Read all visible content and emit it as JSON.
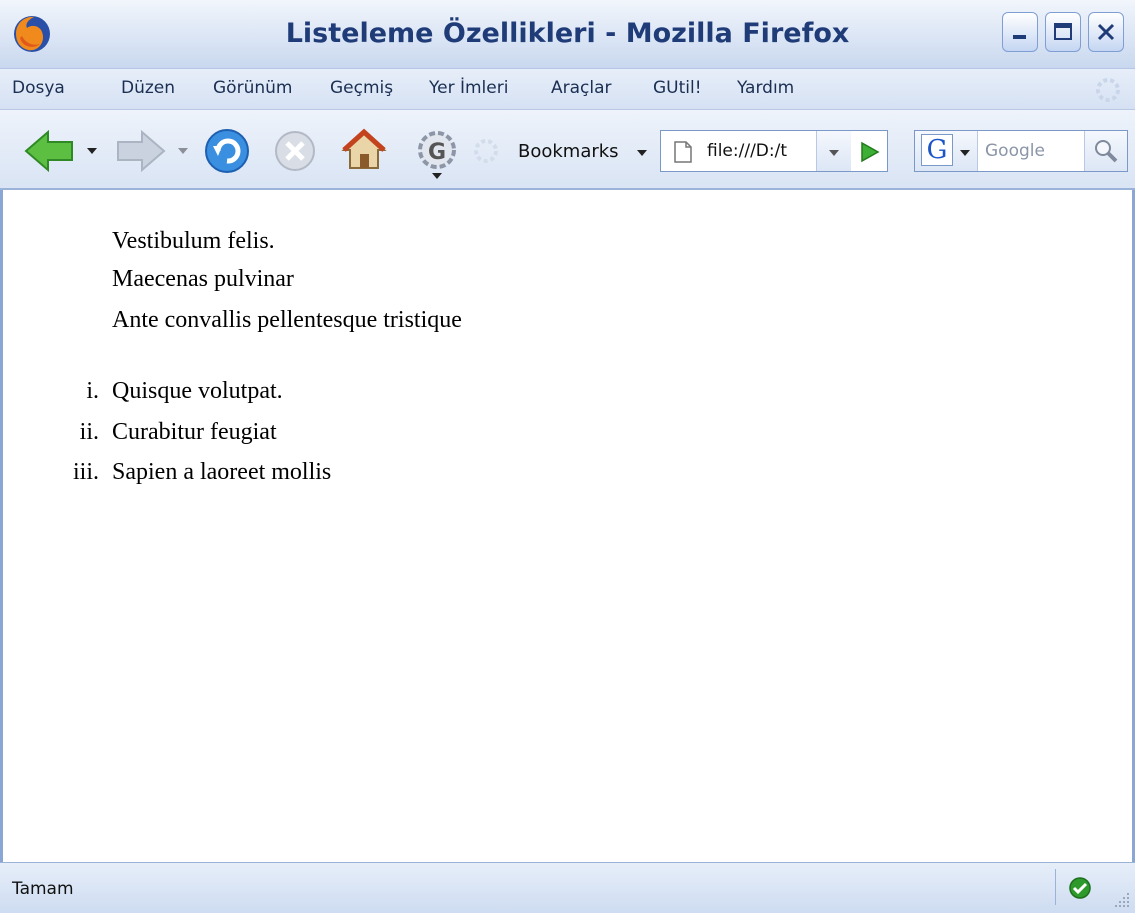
{
  "window": {
    "title": "Listeleme Özellikleri - Mozilla Firefox",
    "app_icon": "firefox-icon",
    "controls": [
      "minimize-icon",
      "maximize-icon",
      "close-icon"
    ]
  },
  "menu": {
    "items": [
      "Dosya",
      "Düzen",
      "Görünüm",
      "Geçmiş",
      "Yer İmleri",
      "Araçlar",
      "GUtil!",
      "Yardım"
    ]
  },
  "toolbar": {
    "icons": [
      "back-icon",
      "forward-icon",
      "reload-icon",
      "stop-icon",
      "home-icon",
      "gear-g-icon",
      "throbber-icon"
    ],
    "bookmarks_label": "Bookmarks",
    "url_value": "file:///D:/t",
    "search_placeholder": "Google",
    "search_engine_letter": "G"
  },
  "content": {
    "plain_list": [
      "Vestibulum felis.",
      "Maecenas pulvinar",
      "Ante convallis pellentesque tristique"
    ],
    "ordered_list": [
      {
        "marker": "i.",
        "text": "Quisque volutpat."
      },
      {
        "marker": "ii.",
        "text": "Curabitur feugiat"
      },
      {
        "marker": "iii.",
        "text": "Sapien a laoreet mollis"
      }
    ]
  },
  "status": {
    "text": "Tamam",
    "icon": "check-ok-icon"
  },
  "colors": {
    "title_text": "#1f3c78",
    "accent": "#8aa6d4",
    "go_green": "#3cb034"
  }
}
